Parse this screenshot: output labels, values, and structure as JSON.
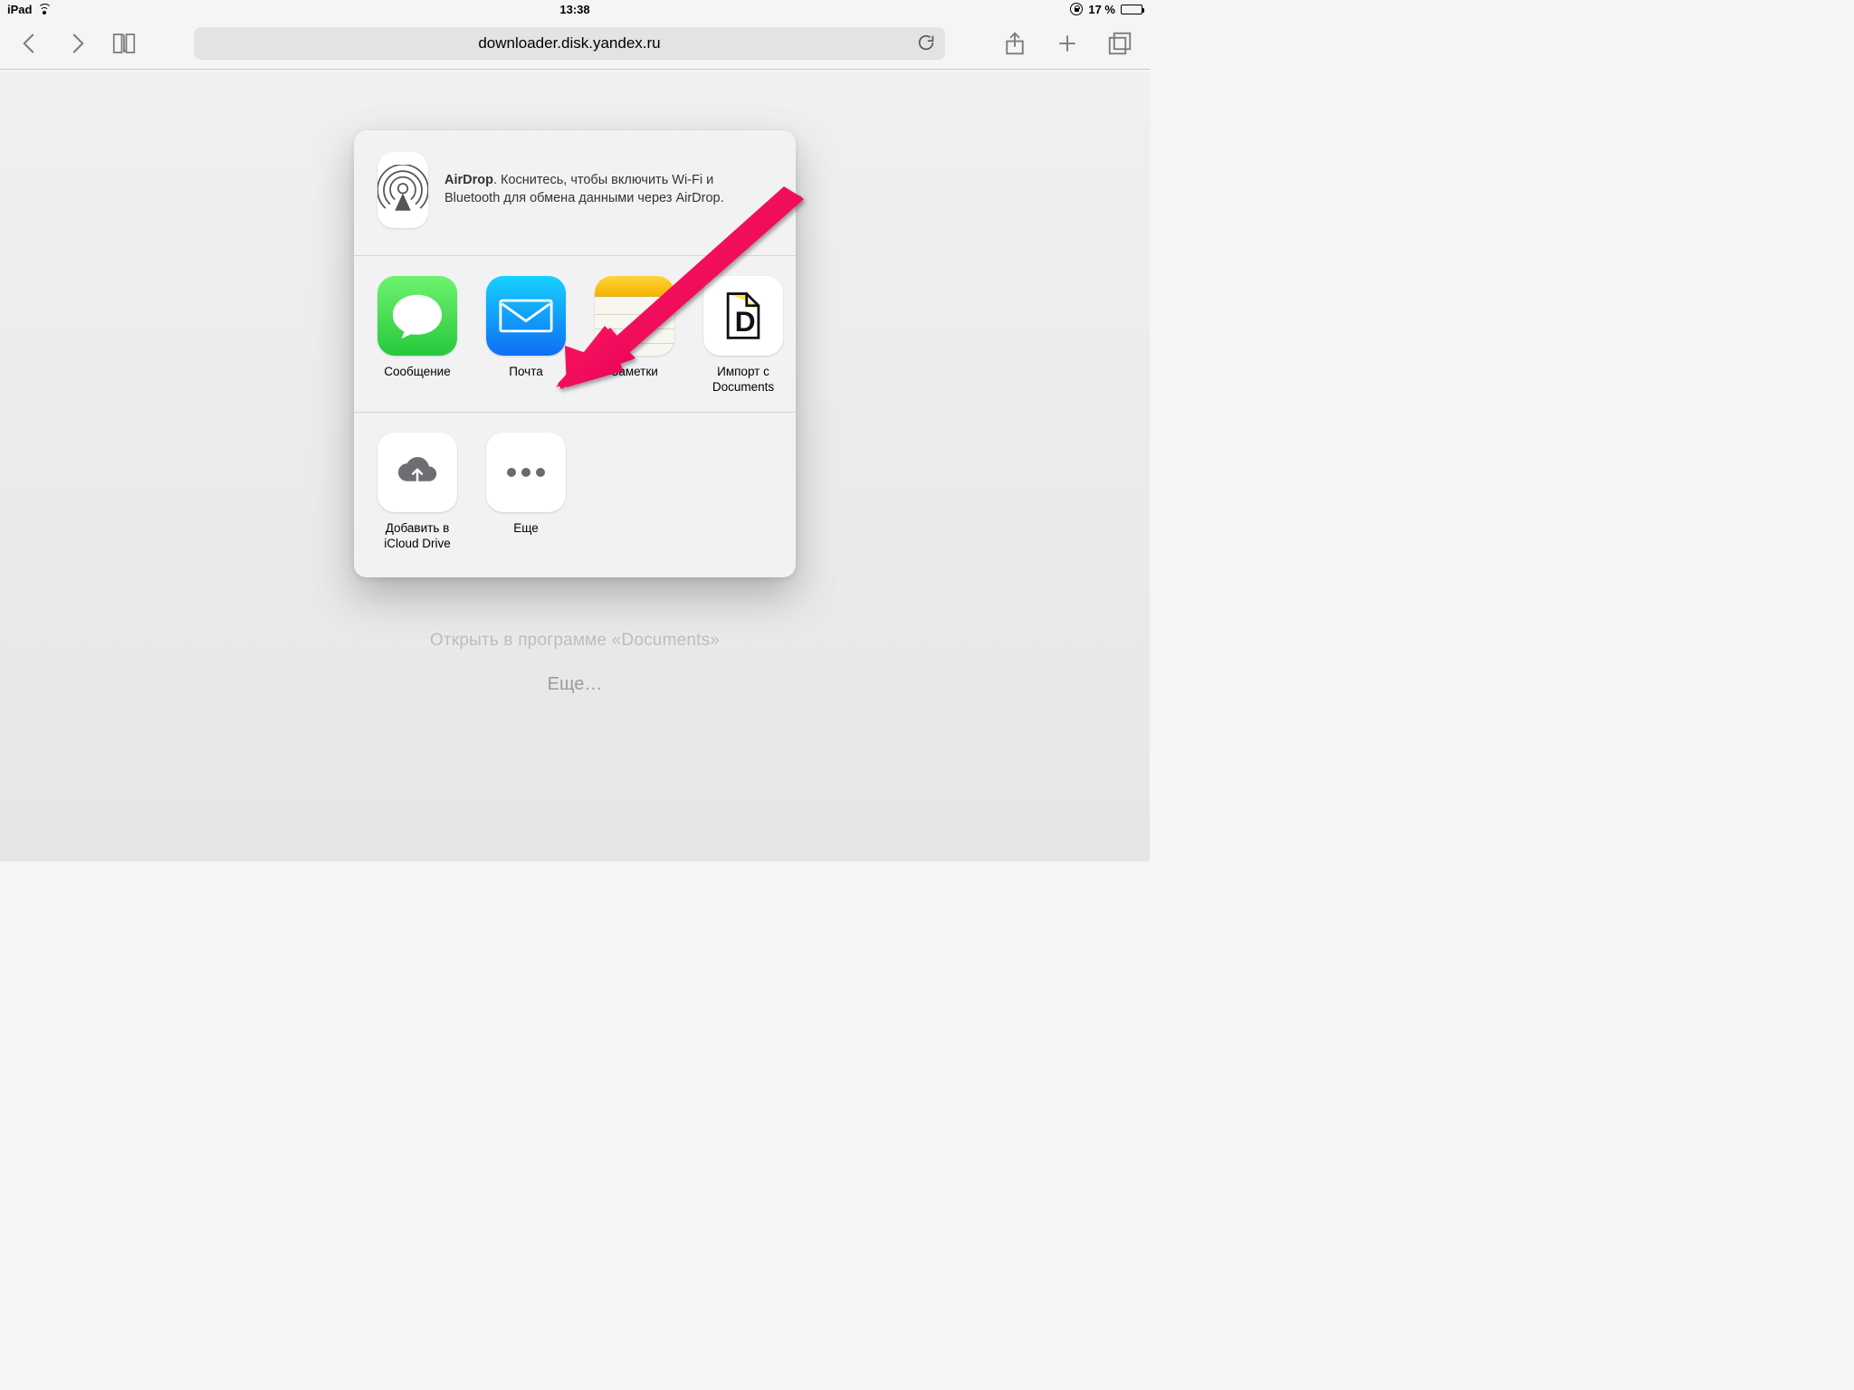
{
  "status": {
    "device": "iPad",
    "time": "13:38",
    "battery_percent": "17 %",
    "battery_fill": 17
  },
  "browser": {
    "url": "downloader.disk.yandex.ru"
  },
  "bg": {
    "open_in": "Открыть в программе «Documents»",
    "more": "Еще…"
  },
  "airdrop": {
    "title": "AirDrop",
    "body": ". Коснитесь, чтобы включить Wi-Fi и Bluetooth для обмена данными через AirDrop."
  },
  "share_apps": [
    {
      "label": "Сообщение"
    },
    {
      "label": "Почта"
    },
    {
      "label": "Заметки"
    },
    {
      "label": "Импорт с Documents"
    }
  ],
  "actions": [
    {
      "label": "Добавить в iCloud Drive"
    },
    {
      "label": "Еще"
    }
  ]
}
